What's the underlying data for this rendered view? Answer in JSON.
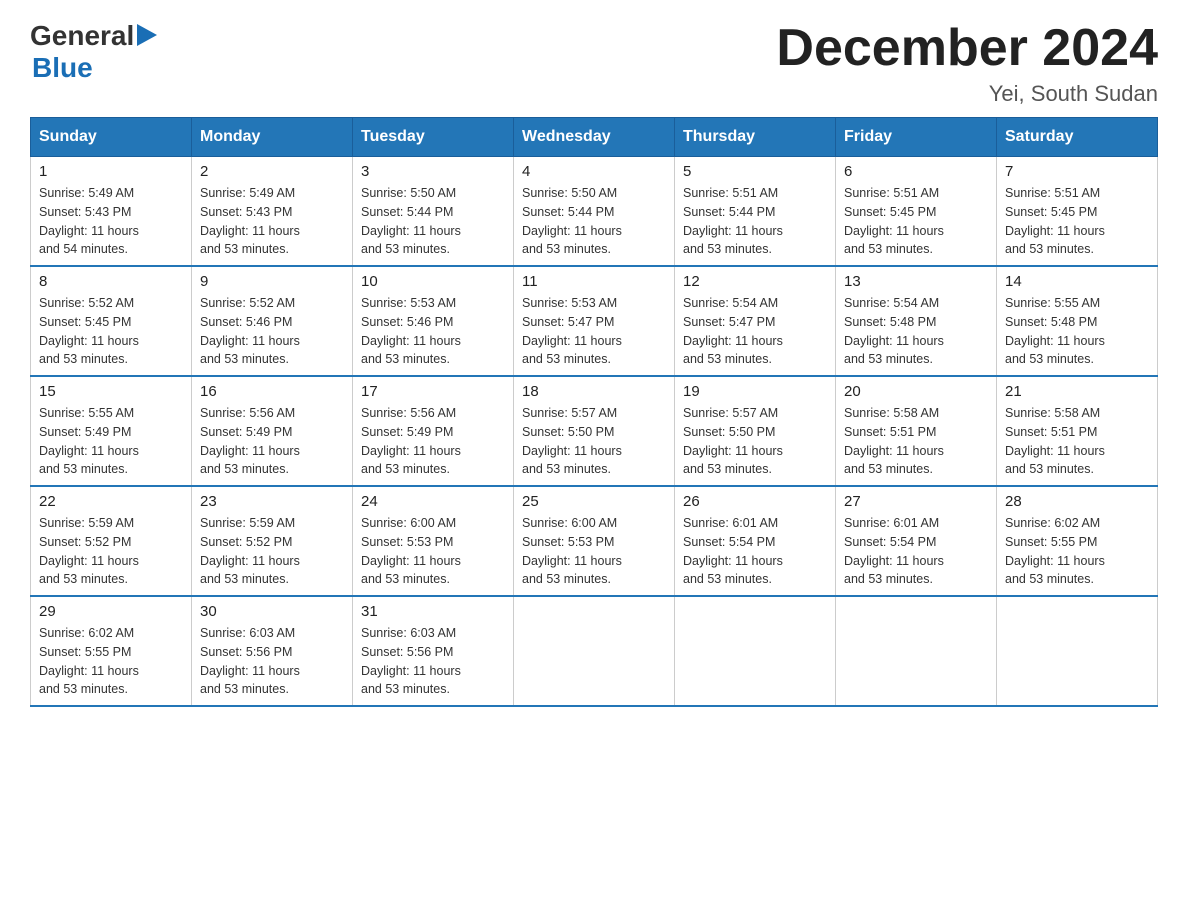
{
  "header": {
    "logo_general": "General",
    "logo_arrow": "▶",
    "logo_blue": "Blue",
    "month_title": "December 2024",
    "location": "Yei, South Sudan"
  },
  "weekdays": [
    "Sunday",
    "Monday",
    "Tuesday",
    "Wednesday",
    "Thursday",
    "Friday",
    "Saturday"
  ],
  "weeks": [
    [
      {
        "day": "1",
        "sunrise": "5:49 AM",
        "sunset": "5:43 PM",
        "daylight": "11 hours and 54 minutes."
      },
      {
        "day": "2",
        "sunrise": "5:49 AM",
        "sunset": "5:43 PM",
        "daylight": "11 hours and 53 minutes."
      },
      {
        "day": "3",
        "sunrise": "5:50 AM",
        "sunset": "5:44 PM",
        "daylight": "11 hours and 53 minutes."
      },
      {
        "day": "4",
        "sunrise": "5:50 AM",
        "sunset": "5:44 PM",
        "daylight": "11 hours and 53 minutes."
      },
      {
        "day": "5",
        "sunrise": "5:51 AM",
        "sunset": "5:44 PM",
        "daylight": "11 hours and 53 minutes."
      },
      {
        "day": "6",
        "sunrise": "5:51 AM",
        "sunset": "5:45 PM",
        "daylight": "11 hours and 53 minutes."
      },
      {
        "day": "7",
        "sunrise": "5:51 AM",
        "sunset": "5:45 PM",
        "daylight": "11 hours and 53 minutes."
      }
    ],
    [
      {
        "day": "8",
        "sunrise": "5:52 AM",
        "sunset": "5:45 PM",
        "daylight": "11 hours and 53 minutes."
      },
      {
        "day": "9",
        "sunrise": "5:52 AM",
        "sunset": "5:46 PM",
        "daylight": "11 hours and 53 minutes."
      },
      {
        "day": "10",
        "sunrise": "5:53 AM",
        "sunset": "5:46 PM",
        "daylight": "11 hours and 53 minutes."
      },
      {
        "day": "11",
        "sunrise": "5:53 AM",
        "sunset": "5:47 PM",
        "daylight": "11 hours and 53 minutes."
      },
      {
        "day": "12",
        "sunrise": "5:54 AM",
        "sunset": "5:47 PM",
        "daylight": "11 hours and 53 minutes."
      },
      {
        "day": "13",
        "sunrise": "5:54 AM",
        "sunset": "5:48 PM",
        "daylight": "11 hours and 53 minutes."
      },
      {
        "day": "14",
        "sunrise": "5:55 AM",
        "sunset": "5:48 PM",
        "daylight": "11 hours and 53 minutes."
      }
    ],
    [
      {
        "day": "15",
        "sunrise": "5:55 AM",
        "sunset": "5:49 PM",
        "daylight": "11 hours and 53 minutes."
      },
      {
        "day": "16",
        "sunrise": "5:56 AM",
        "sunset": "5:49 PM",
        "daylight": "11 hours and 53 minutes."
      },
      {
        "day": "17",
        "sunrise": "5:56 AM",
        "sunset": "5:49 PM",
        "daylight": "11 hours and 53 minutes."
      },
      {
        "day": "18",
        "sunrise": "5:57 AM",
        "sunset": "5:50 PM",
        "daylight": "11 hours and 53 minutes."
      },
      {
        "day": "19",
        "sunrise": "5:57 AM",
        "sunset": "5:50 PM",
        "daylight": "11 hours and 53 minutes."
      },
      {
        "day": "20",
        "sunrise": "5:58 AM",
        "sunset": "5:51 PM",
        "daylight": "11 hours and 53 minutes."
      },
      {
        "day": "21",
        "sunrise": "5:58 AM",
        "sunset": "5:51 PM",
        "daylight": "11 hours and 53 minutes."
      }
    ],
    [
      {
        "day": "22",
        "sunrise": "5:59 AM",
        "sunset": "5:52 PM",
        "daylight": "11 hours and 53 minutes."
      },
      {
        "day": "23",
        "sunrise": "5:59 AM",
        "sunset": "5:52 PM",
        "daylight": "11 hours and 53 minutes."
      },
      {
        "day": "24",
        "sunrise": "6:00 AM",
        "sunset": "5:53 PM",
        "daylight": "11 hours and 53 minutes."
      },
      {
        "day": "25",
        "sunrise": "6:00 AM",
        "sunset": "5:53 PM",
        "daylight": "11 hours and 53 minutes."
      },
      {
        "day": "26",
        "sunrise": "6:01 AM",
        "sunset": "5:54 PM",
        "daylight": "11 hours and 53 minutes."
      },
      {
        "day": "27",
        "sunrise": "6:01 AM",
        "sunset": "5:54 PM",
        "daylight": "11 hours and 53 minutes."
      },
      {
        "day": "28",
        "sunrise": "6:02 AM",
        "sunset": "5:55 PM",
        "daylight": "11 hours and 53 minutes."
      }
    ],
    [
      {
        "day": "29",
        "sunrise": "6:02 AM",
        "sunset": "5:55 PM",
        "daylight": "11 hours and 53 minutes."
      },
      {
        "day": "30",
        "sunrise": "6:03 AM",
        "sunset": "5:56 PM",
        "daylight": "11 hours and 53 minutes."
      },
      {
        "day": "31",
        "sunrise": "6:03 AM",
        "sunset": "5:56 PM",
        "daylight": "11 hours and 53 minutes."
      },
      null,
      null,
      null,
      null
    ]
  ],
  "labels": {
    "sunrise": "Sunrise:",
    "sunset": "Sunset:",
    "daylight": "Daylight:"
  }
}
